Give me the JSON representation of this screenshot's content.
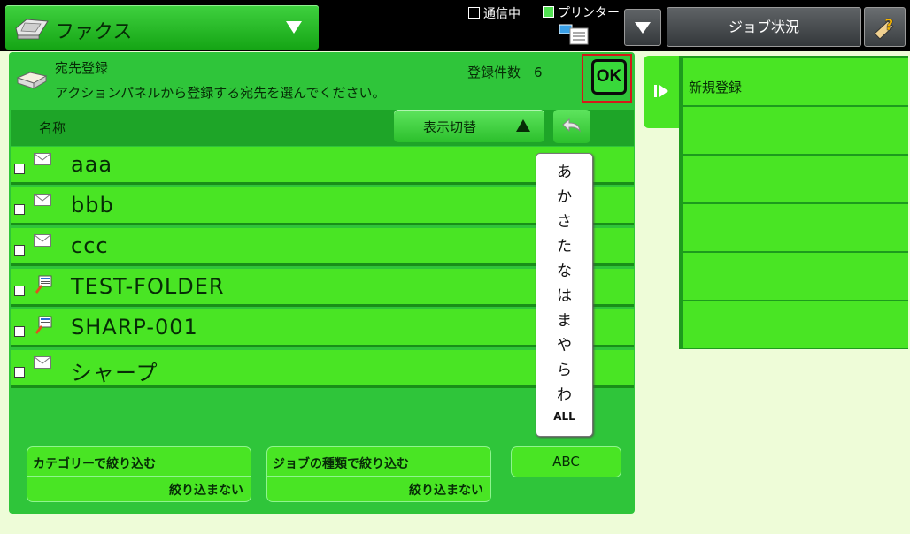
{
  "header": {
    "mode_label": "ファクス",
    "status_comm": "通信中",
    "status_printer": "プリンター",
    "job_status_label": "ジョブ状況"
  },
  "panel": {
    "title": "宛先登録",
    "message": "アクションパネルから登録する宛先を選んでください。",
    "count_label": "登録件数",
    "count_value": "6",
    "ok_label": "OK"
  },
  "list": {
    "column_name": "名称",
    "view_switch_label": "表示切替",
    "rows": [
      {
        "name": "aaa",
        "icon": "mail-icon"
      },
      {
        "name": "bbb",
        "icon": "mail-icon"
      },
      {
        "name": "ccc",
        "icon": "mail-icon"
      },
      {
        "name": "TEST-FOLDER",
        "icon": "folder-address-icon"
      },
      {
        "name": "SHARP-001",
        "icon": "folder-address-icon"
      },
      {
        "name": "シャープ",
        "icon": "mail-icon"
      }
    ]
  },
  "kana_index": [
    "あ",
    "か",
    "さ",
    "た",
    "な",
    "は",
    "ま",
    "や",
    "ら",
    "わ",
    "ALL"
  ],
  "filters": {
    "category_title": "カテゴリーで絞り込む",
    "category_value": "絞り込まない",
    "jobtype_title": "ジョブの種類で絞り込む",
    "jobtype_value": "絞り込まない",
    "abc_label": "ABC"
  },
  "action_panel": {
    "items": [
      "新規登録",
      "",
      "",
      "",
      "",
      ""
    ]
  }
}
